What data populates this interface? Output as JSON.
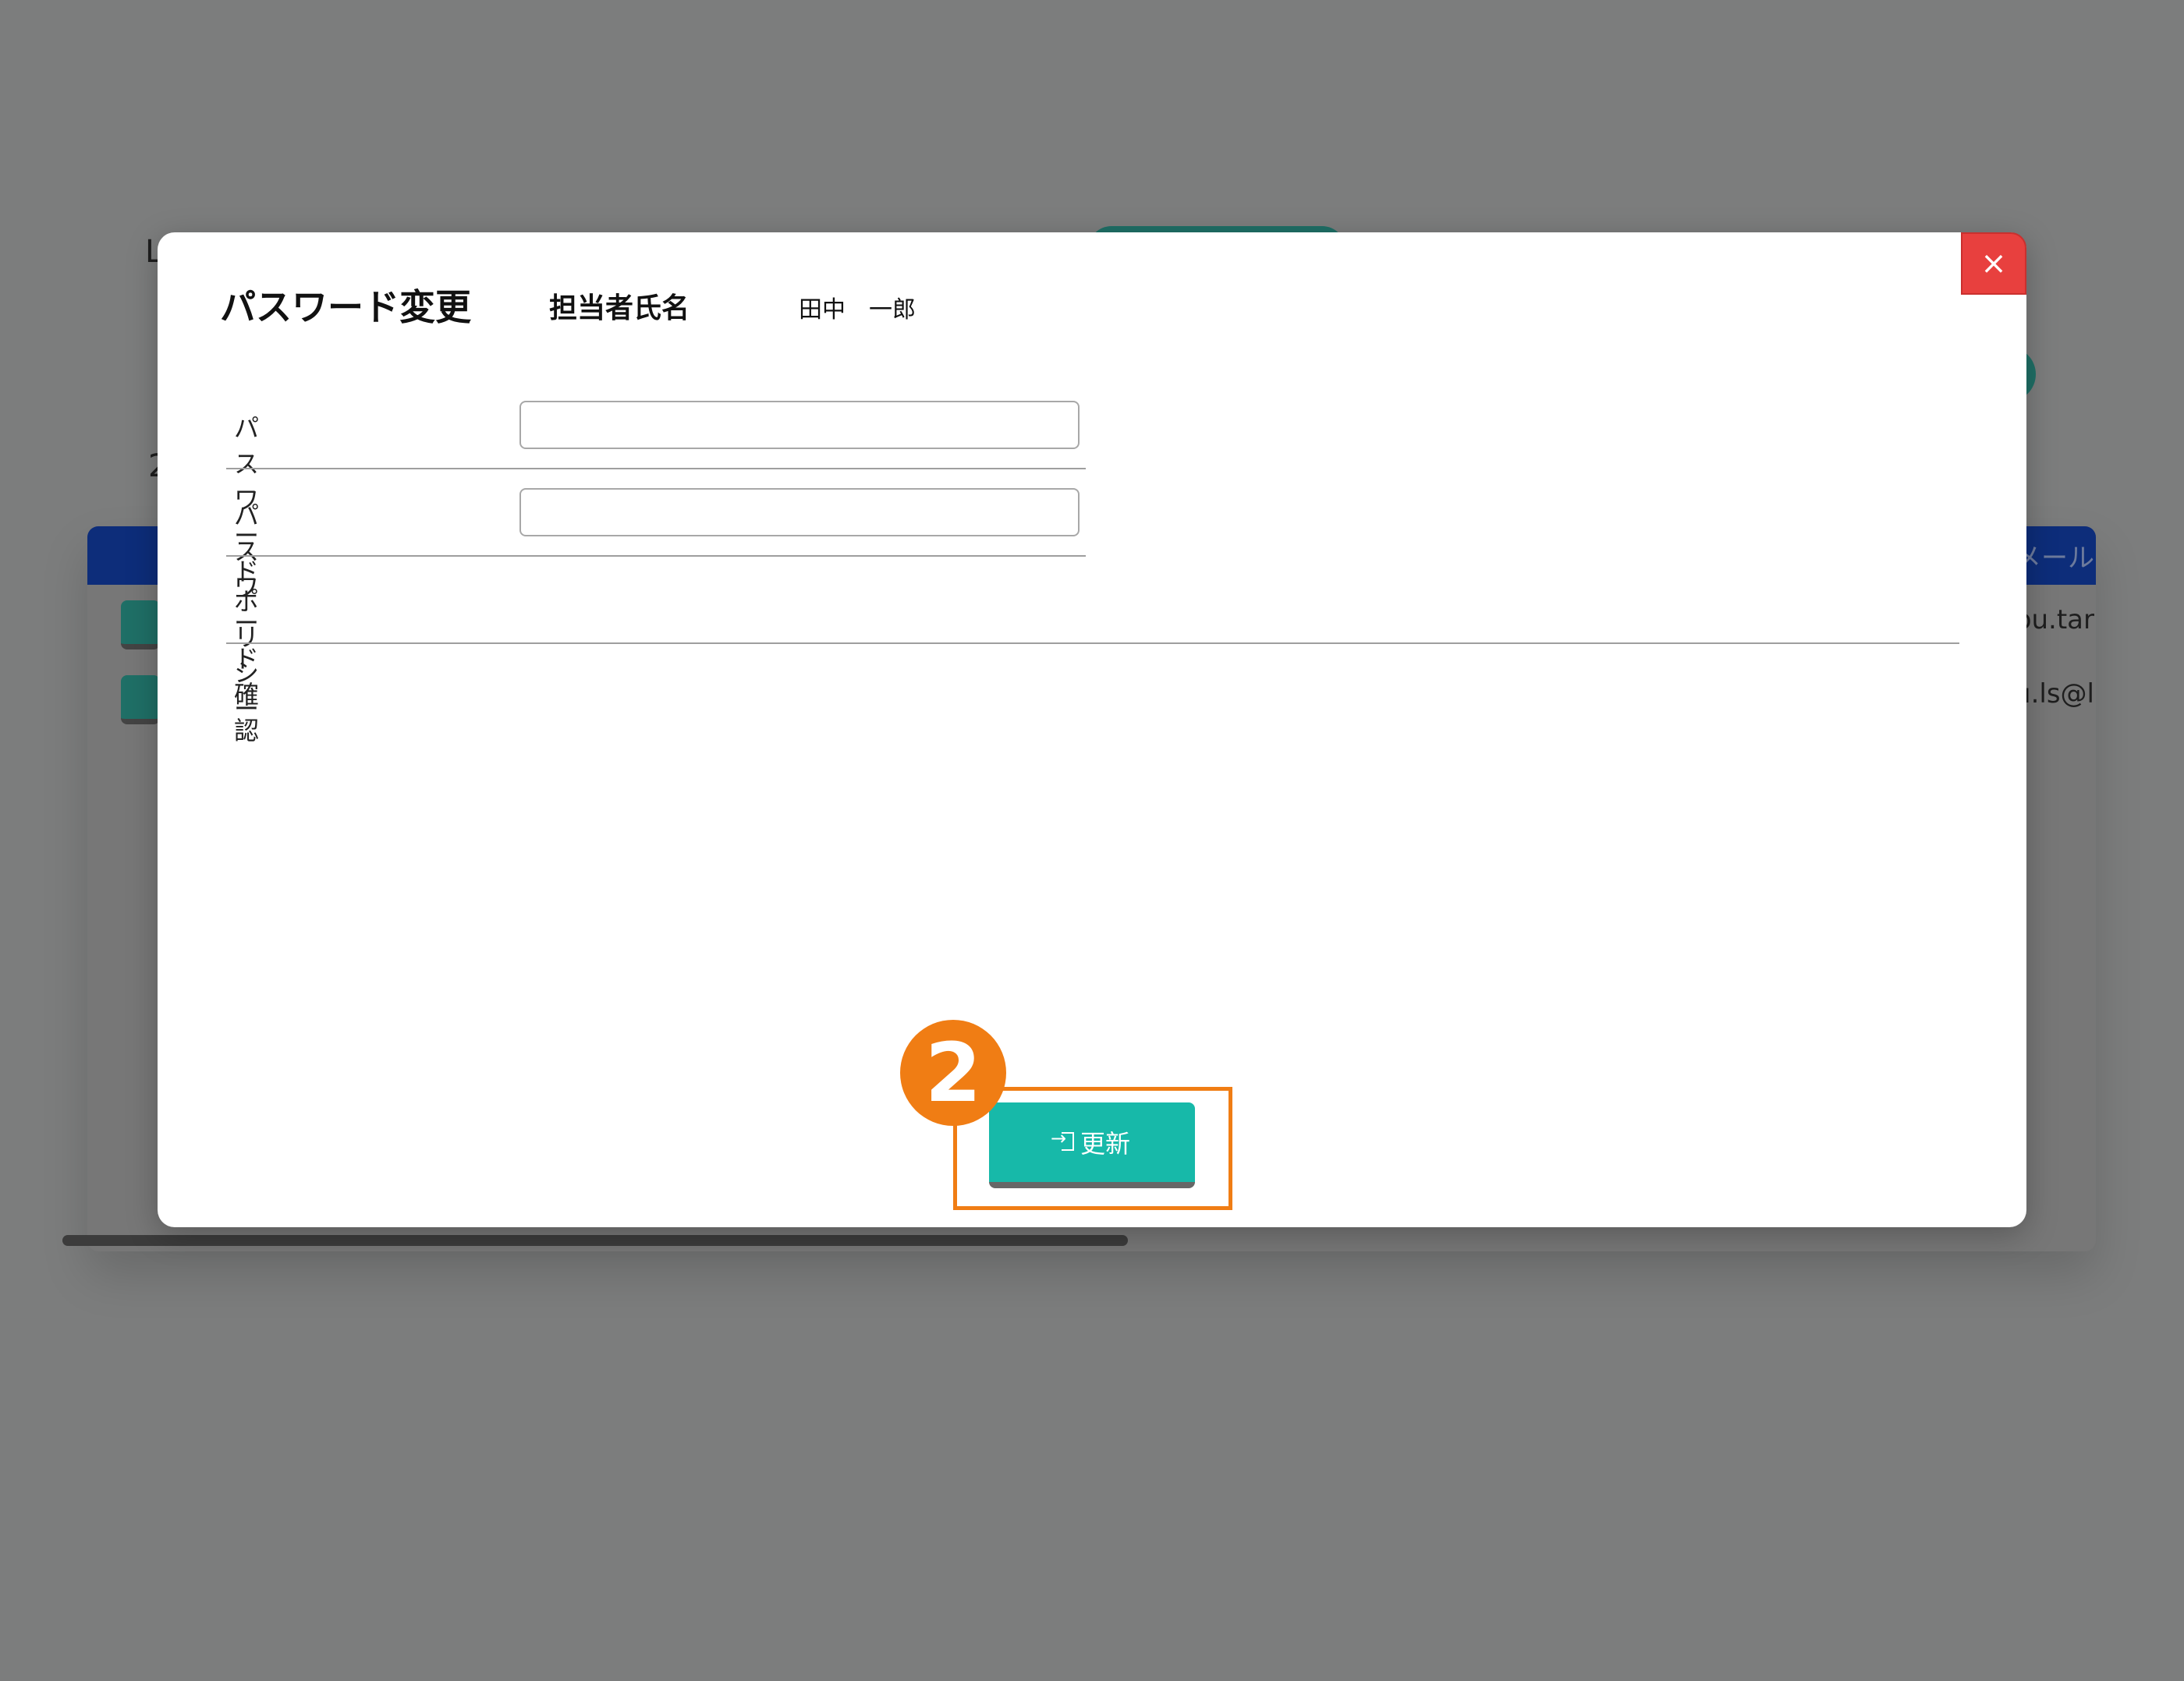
{
  "background": {
    "column_header_partial": "メール",
    "rows": [
      {
        "email_partial": "ou.tar"
      },
      {
        "email_partial": "u.ls@l"
      }
    ]
  },
  "modal": {
    "title": "パスワード変更",
    "staff_label": "担当者氏名",
    "staff_value": "田中　一郎",
    "close_icon": "×",
    "fields": [
      {
        "label": "パスワード",
        "value": "",
        "placeholder": ""
      },
      {
        "label": "パスワード確認",
        "value": "",
        "placeholder": ""
      }
    ],
    "policy_label": "ポリシー",
    "update_button_label": "更新"
  },
  "annotation": {
    "step_number": "2",
    "highlight_color": "#f07d14"
  },
  "colors": {
    "accent": "#17b9a9",
    "close": "#e8403e",
    "overlay": "#7c7d7d"
  }
}
